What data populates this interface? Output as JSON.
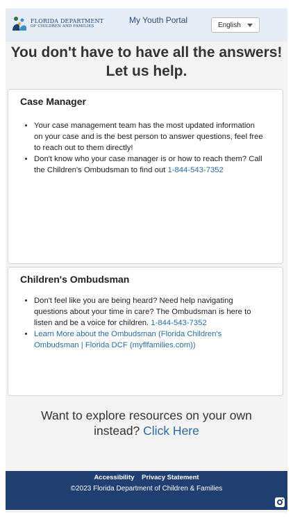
{
  "header": {
    "logo_line1": "FLORIDA DEPARTMENT",
    "logo_line2": "OF CHILDREN AND FAMILIES",
    "portal_title": "My Youth Portal",
    "language_selected": "English"
  },
  "hero": {
    "line1": "You don't have to have all the answers!",
    "line2": "Let us help."
  },
  "case_manager": {
    "title": "Case Manager",
    "bullet1": "Your case management team has the most updated information on your case and is the best person to answer questions, feel free to reach out to them directly!",
    "bullet2_text": "Don't know who your case manager is or how to reach them? Call the Children's Ombudsman to find out ",
    "bullet2_phone": "1-844-543-7352"
  },
  "ombudsman": {
    "title": "Children's Ombudsman",
    "bullet1_text": "Don't feel like you are being heard? Need help navigating questions about your time in care? The Ombudsman is here to listen and be a voice for children. ",
    "bullet1_phone": "1-844-543-7352",
    "bullet2_link": "Learn More about the Ombudsman (Florida Children's Ombudsman | Florida DCF (myflfamilies.com))"
  },
  "explore": {
    "line1": "Want to explore resources on your own",
    "line2_prefix": "instead? ",
    "link": "Click Here"
  },
  "footer": {
    "accessibility": "Accessibility",
    "privacy": "Privacy Statement",
    "copyright": "©2023 Florida Department of Children & Families"
  },
  "colors": {
    "header_bg": "#e6edf7",
    "brand_navy": "#1e3f70",
    "link_blue": "#2a68a8"
  },
  "icons": {
    "logo": "dcf-family-logo-icon",
    "dropdown": "chevron-down-icon",
    "social": "instagram-icon"
  }
}
